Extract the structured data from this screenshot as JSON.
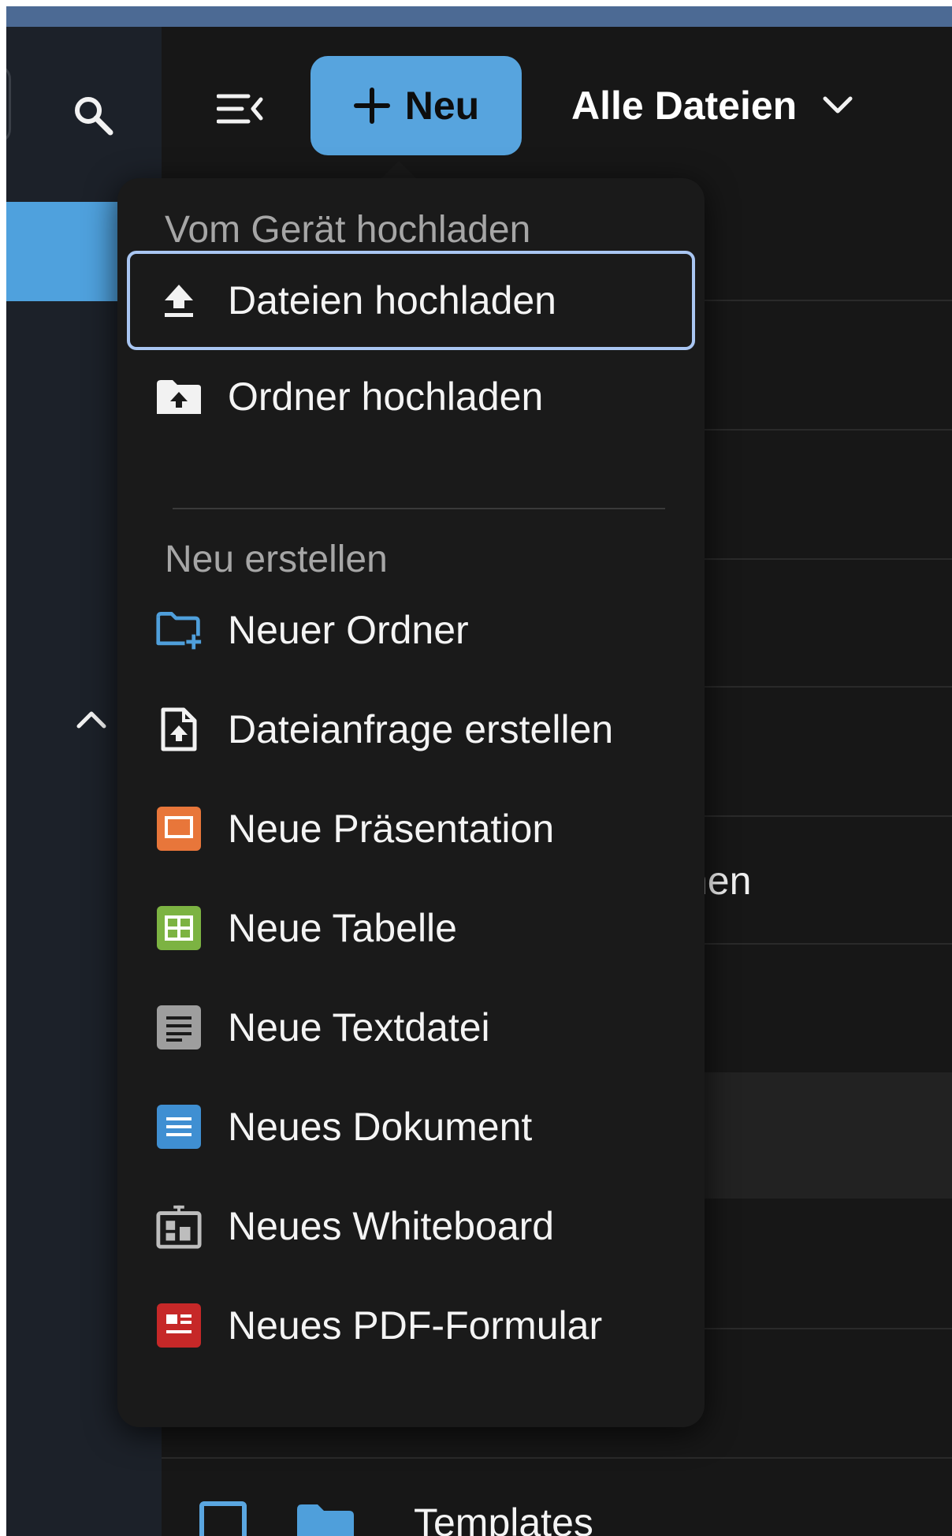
{
  "header": {
    "new_button_label": "Neu",
    "files_dropdown_label": "Alle Dateien"
  },
  "list": {
    "partial_row_text": "nen",
    "templates_row_name": "Templates"
  },
  "new_menu": {
    "upload_section_title": "Vom Gerät hochladen",
    "upload_items": [
      {
        "label": "Dateien hochladen",
        "icon": "upload-icon"
      },
      {
        "label": "Ordner hochladen",
        "icon": "folder-upload-icon"
      }
    ],
    "create_section_title": "Neu erstellen",
    "create_items": [
      {
        "label": "Neuer Ordner",
        "icon": "new-folder-icon"
      },
      {
        "label": "Dateianfrage erstellen",
        "icon": "file-request-icon"
      },
      {
        "label": "Neue Präsentation",
        "icon": "presentation-icon"
      },
      {
        "label": "Neue Tabelle",
        "icon": "spreadsheet-icon"
      },
      {
        "label": "Neue Textdatei",
        "icon": "text-file-icon"
      },
      {
        "label": "Neues Dokument",
        "icon": "document-icon"
      },
      {
        "label": "Neues Whiteboard",
        "icon": "whiteboard-icon"
      },
      {
        "label": "Neues PDF-Formular",
        "icon": "pdf-form-icon"
      }
    ]
  },
  "colors": {
    "accent": "#57a4de",
    "background": "#171717",
    "sidebar": "#1c2129",
    "menu_background": "#1a1a1a",
    "focus_ring": "#a9c6f2",
    "presentation": "#e8763a",
    "spreadsheet": "#7cb342",
    "text_file": "#9e9e9e",
    "document": "#3f8fd2",
    "pdf_form": "#c62828"
  }
}
